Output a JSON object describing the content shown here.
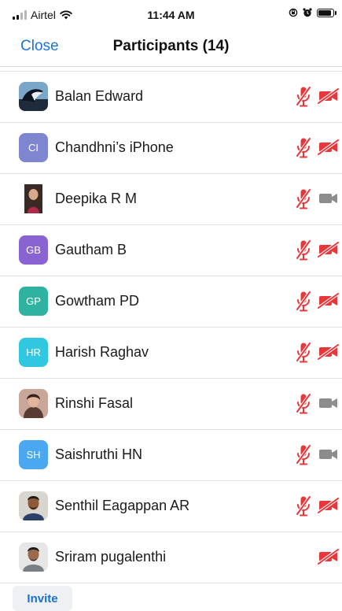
{
  "status_bar": {
    "carrier": "Airtel",
    "time": "11:44 AM",
    "icons": [
      "signal-icon",
      "wifi-icon",
      "orientation-lock-icon",
      "alarm-icon",
      "battery-icon"
    ]
  },
  "nav": {
    "close_label": "Close",
    "title": "Participants (14)"
  },
  "colors": {
    "accent": "#1a73d9",
    "muted_red": "#e8373a",
    "video_off_grey": "#8c8c8c"
  },
  "participants": [
    {
      "name": "Balan Edward",
      "avatar": "photo",
      "mic": "muted-icon",
      "video": "video-off-icon"
    },
    {
      "name": "Chandhni’s iPhone",
      "avatar": "initials",
      "initials": "CI",
      "avatar_color": "#7e86cf",
      "mic": "muted-icon",
      "video": "video-off-icon"
    },
    {
      "name": "Deepika R M",
      "avatar": "photo",
      "mic": "muted-icon",
      "video": "video-icon"
    },
    {
      "name": "Gautham B",
      "avatar": "initials",
      "initials": "GB",
      "avatar_color": "#8a63d2",
      "mic": "muted-icon",
      "video": "video-off-icon"
    },
    {
      "name": "Gowtham PD",
      "avatar": "initials",
      "initials": "GP",
      "avatar_color": "#2fb3a0",
      "mic": "muted-icon",
      "video": "video-off-icon"
    },
    {
      "name": "Harish Raghav",
      "avatar": "initials",
      "initials": "HR",
      "avatar_color": "#30c8e0",
      "mic": "muted-icon",
      "video": "video-off-icon"
    },
    {
      "name": "Rinshi Fasal",
      "avatar": "photo",
      "mic": "muted-icon",
      "video": "video-icon"
    },
    {
      "name": "Saishruthi HN",
      "avatar": "initials",
      "initials": "SH",
      "avatar_color": "#4aa8f0",
      "mic": "muted-icon",
      "video": "video-icon"
    },
    {
      "name": "Senthil Eagappan AR",
      "avatar": "photo",
      "mic": "muted-icon",
      "video": "video-off-icon"
    },
    {
      "name": "Sriram pugalenthi",
      "avatar": "photo",
      "mic": "none",
      "video": "video-off-icon"
    }
  ],
  "footer": {
    "invite_label": "Invite"
  }
}
